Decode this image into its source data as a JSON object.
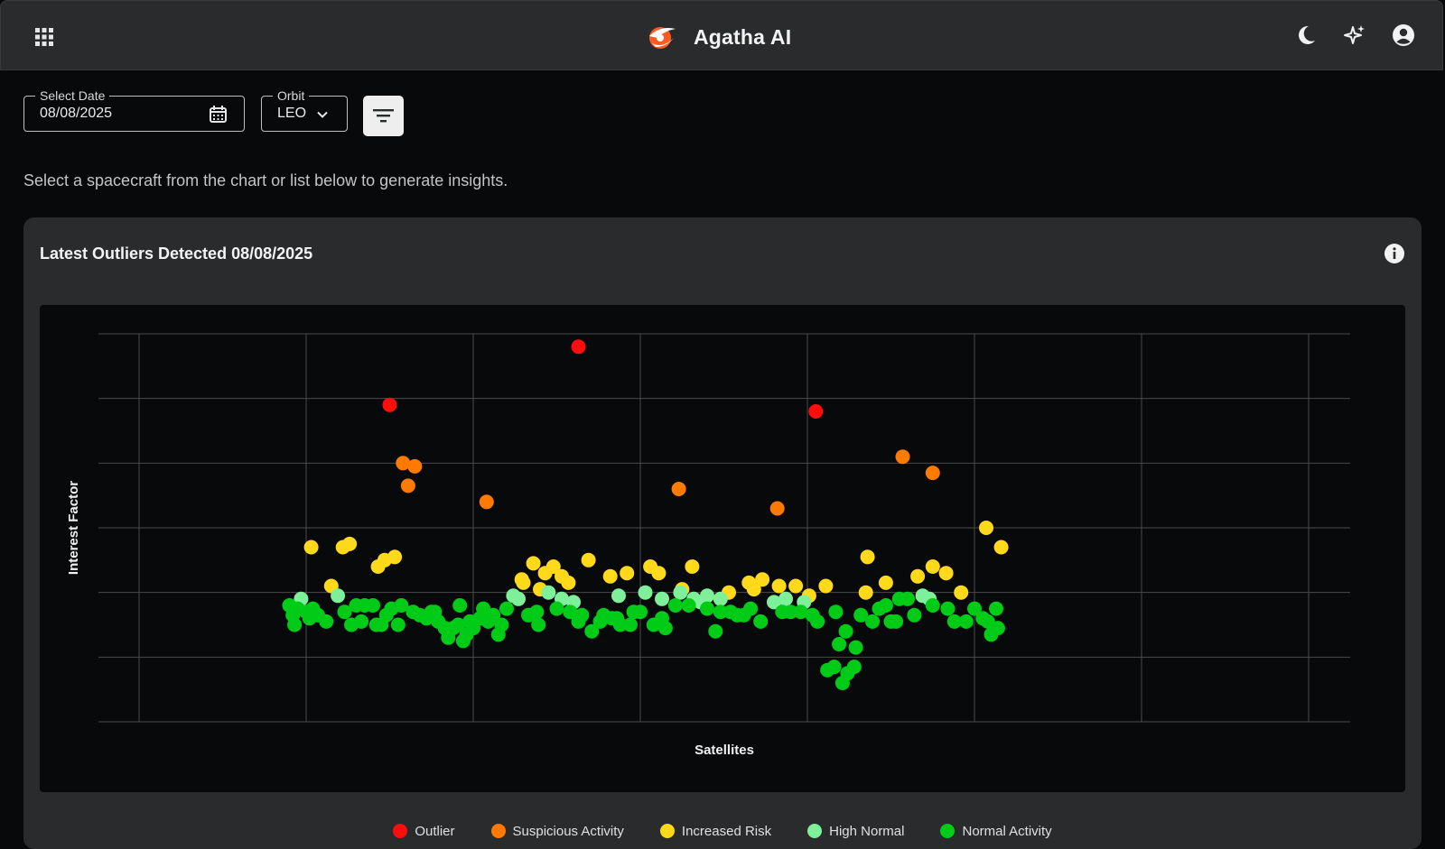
{
  "app": {
    "title": "Agatha AI"
  },
  "filters": {
    "date_label": "Select Date",
    "date_value": "08/08/2025",
    "orbit_label": "Orbit",
    "orbit_value": "LEO"
  },
  "hint_text": "Select a spacecraft from the chart or list below to generate insights.",
  "card": {
    "title": "Latest Outliers Detected 08/08/2025"
  },
  "colors": {
    "outlier": "#ff0d0d",
    "suspicious": "#ff7a00",
    "increased": "#ffd91a",
    "high_normal": "#7ff09a",
    "normal": "#00cc18"
  },
  "legend": [
    {
      "key": "outlier",
      "label": "Outlier"
    },
    {
      "key": "suspicious",
      "label": "Suspicious Activity"
    },
    {
      "key": "increased",
      "label": "Increased Risk"
    },
    {
      "key": "high_normal",
      "label": "High Normal"
    },
    {
      "key": "normal",
      "label": "Normal Activity"
    }
  ],
  "chart_data": {
    "type": "scatter",
    "xlabel": "Satellites",
    "ylabel": "Interest Factor",
    "xlim": [
      0,
      7
    ],
    "ylim": [
      0,
      6
    ],
    "grid": true,
    "legend_position": "bottom",
    "series": [
      {
        "key": "outlier",
        "points": [
          [
            1.5,
            4.9
          ],
          [
            2.63,
            5.8
          ],
          [
            4.05,
            4.8
          ]
        ]
      },
      {
        "key": "suspicious",
        "points": [
          [
            1.58,
            4.0
          ],
          [
            1.61,
            3.65
          ],
          [
            1.65,
            3.95
          ],
          [
            2.08,
            3.4
          ],
          [
            3.23,
            3.6
          ],
          [
            3.82,
            3.3
          ],
          [
            4.57,
            4.1
          ],
          [
            4.75,
            3.85
          ]
        ]
      },
      {
        "key": "increased",
        "points": [
          [
            1.03,
            2.7
          ],
          [
            1.15,
            2.1
          ],
          [
            1.22,
            2.7
          ],
          [
            1.26,
            2.75
          ],
          [
            1.43,
            2.4
          ],
          [
            1.47,
            2.5
          ],
          [
            1.53,
            2.55
          ],
          [
            2.29,
            2.2
          ],
          [
            2.3,
            2.15
          ],
          [
            2.36,
            2.45
          ],
          [
            2.4,
            2.05
          ],
          [
            2.43,
            2.3
          ],
          [
            2.48,
            2.4
          ],
          [
            2.53,
            2.25
          ],
          [
            2.57,
            2.15
          ],
          [
            2.69,
            2.5
          ],
          [
            2.82,
            2.25
          ],
          [
            2.92,
            2.3
          ],
          [
            3.06,
            2.4
          ],
          [
            3.11,
            2.3
          ],
          [
            3.25,
            2.05
          ],
          [
            3.31,
            2.4
          ],
          [
            3.53,
            2.0
          ],
          [
            3.65,
            2.15
          ],
          [
            3.68,
            2.05
          ],
          [
            3.73,
            2.2
          ],
          [
            3.83,
            2.1
          ],
          [
            3.93,
            2.1
          ],
          [
            4.01,
            1.95
          ],
          [
            4.11,
            2.1
          ],
          [
            4.35,
            2.0
          ],
          [
            4.36,
            2.55
          ],
          [
            4.47,
            2.15
          ],
          [
            4.66,
            2.25
          ],
          [
            4.75,
            2.4
          ],
          [
            4.83,
            2.3
          ],
          [
            4.92,
            2.0
          ],
          [
            5.07,
            3.0
          ],
          [
            5.16,
            2.7
          ]
        ]
      },
      {
        "key": "high_normal",
        "points": [
          [
            0.97,
            1.9
          ],
          [
            1.19,
            1.95
          ],
          [
            2.24,
            1.95
          ],
          [
            2.27,
            1.9
          ],
          [
            2.45,
            2.0
          ],
          [
            2.53,
            1.9
          ],
          [
            2.6,
            1.85
          ],
          [
            2.87,
            1.95
          ],
          [
            3.03,
            2.0
          ],
          [
            3.13,
            1.9
          ],
          [
            3.24,
            2.0
          ],
          [
            3.32,
            1.9
          ],
          [
            3.36,
            1.85
          ],
          [
            3.4,
            1.95
          ],
          [
            3.48,
            1.9
          ],
          [
            3.8,
            1.85
          ],
          [
            3.87,
            1.9
          ],
          [
            3.98,
            1.85
          ],
          [
            4.69,
            1.95
          ],
          [
            4.73,
            1.9
          ]
        ]
      },
      {
        "key": "normal",
        "points": [
          [
            0.9,
            1.8
          ],
          [
            0.92,
            1.65
          ],
          [
            0.93,
            1.5
          ],
          [
            0.95,
            1.75
          ],
          [
            1.0,
            1.7
          ],
          [
            1.02,
            1.6
          ],
          [
            1.04,
            1.75
          ],
          [
            1.07,
            1.65
          ],
          [
            1.12,
            1.55
          ],
          [
            1.23,
            1.7
          ],
          [
            1.27,
            1.5
          ],
          [
            1.3,
            1.8
          ],
          [
            1.33,
            1.55
          ],
          [
            1.35,
            1.8
          ],
          [
            1.4,
            1.8
          ],
          [
            1.42,
            1.5
          ],
          [
            1.45,
            1.5
          ],
          [
            1.48,
            1.65
          ],
          [
            1.51,
            1.75
          ],
          [
            1.55,
            1.5
          ],
          [
            1.57,
            1.8
          ],
          [
            1.64,
            1.7
          ],
          [
            1.68,
            1.65
          ],
          [
            1.72,
            1.6
          ],
          [
            1.75,
            1.7
          ],
          [
            1.77,
            1.7
          ],
          [
            1.79,
            1.55
          ],
          [
            1.83,
            1.45
          ],
          [
            1.85,
            1.3
          ],
          [
            1.88,
            1.45
          ],
          [
            1.91,
            1.5
          ],
          [
            1.92,
            1.8
          ],
          [
            1.94,
            1.25
          ],
          [
            1.96,
            1.35
          ],
          [
            1.98,
            1.55
          ],
          [
            2.0,
            1.45
          ],
          [
            2.04,
            1.6
          ],
          [
            2.06,
            1.75
          ],
          [
            2.09,
            1.55
          ],
          [
            2.12,
            1.65
          ],
          [
            2.15,
            1.35
          ],
          [
            2.17,
            1.5
          ],
          [
            2.2,
            1.75
          ],
          [
            2.33,
            1.65
          ],
          [
            2.38,
            1.7
          ],
          [
            2.39,
            1.5
          ],
          [
            2.5,
            1.75
          ],
          [
            2.58,
            1.7
          ],
          [
            2.63,
            1.55
          ],
          [
            2.65,
            1.65
          ],
          [
            2.71,
            1.4
          ],
          [
            2.76,
            1.55
          ],
          [
            2.78,
            1.65
          ],
          [
            2.83,
            1.6
          ],
          [
            2.86,
            1.6
          ],
          [
            2.88,
            1.5
          ],
          [
            2.94,
            1.5
          ],
          [
            2.96,
            1.7
          ],
          [
            3.0,
            1.7
          ],
          [
            3.08,
            1.5
          ],
          [
            3.13,
            1.6
          ],
          [
            3.15,
            1.45
          ],
          [
            3.21,
            1.8
          ],
          [
            3.29,
            1.8
          ],
          [
            3.4,
            1.75
          ],
          [
            3.45,
            1.4
          ],
          [
            3.48,
            1.7
          ],
          [
            3.54,
            1.7
          ],
          [
            3.58,
            1.65
          ],
          [
            3.62,
            1.65
          ],
          [
            3.66,
            1.75
          ],
          [
            3.72,
            1.55
          ],
          [
            3.85,
            1.7
          ],
          [
            3.9,
            1.7
          ],
          [
            3.96,
            1.7
          ],
          [
            4.03,
            1.65
          ],
          [
            4.06,
            1.55
          ],
          [
            4.12,
            0.8
          ],
          [
            4.16,
            0.85
          ],
          [
            4.17,
            1.7
          ],
          [
            4.19,
            1.2
          ],
          [
            4.21,
            0.6
          ],
          [
            4.23,
            1.4
          ],
          [
            4.24,
            0.75
          ],
          [
            4.28,
            0.85
          ],
          [
            4.29,
            1.15
          ],
          [
            4.32,
            1.65
          ],
          [
            4.39,
            1.55
          ],
          [
            4.43,
            1.75
          ],
          [
            4.47,
            1.8
          ],
          [
            4.5,
            1.55
          ],
          [
            4.53,
            1.55
          ],
          [
            4.55,
            1.9
          ],
          [
            4.6,
            1.9
          ],
          [
            4.64,
            1.65
          ],
          [
            4.75,
            1.8
          ],
          [
            4.84,
            1.75
          ],
          [
            4.88,
            1.55
          ],
          [
            4.95,
            1.55
          ],
          [
            5.0,
            1.75
          ],
          [
            5.05,
            1.6
          ],
          [
            5.08,
            1.55
          ],
          [
            5.1,
            1.35
          ],
          [
            5.13,
            1.75
          ],
          [
            5.14,
            1.45
          ]
        ]
      }
    ]
  }
}
